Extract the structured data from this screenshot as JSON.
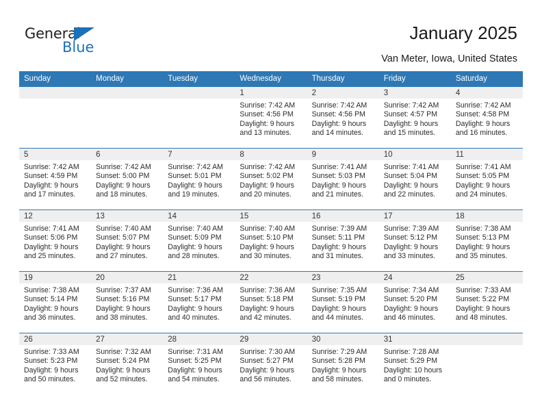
{
  "brand": {
    "name_top": "General",
    "name_bottom": "Blue",
    "accent_color": "#1c71b8"
  },
  "header": {
    "title": "January 2025",
    "subtitle": "Van Meter, Iowa, United States"
  },
  "calendar": {
    "header_background": "#2e78b5",
    "daynum_background": "#efefef",
    "weekday_headers": [
      "Sunday",
      "Monday",
      "Tuesday",
      "Wednesday",
      "Thursday",
      "Friday",
      "Saturday"
    ],
    "weeks": [
      [
        {
          "day": "",
          "lines": []
        },
        {
          "day": "",
          "lines": []
        },
        {
          "day": "",
          "lines": []
        },
        {
          "day": "1",
          "lines": [
            "Sunrise: 7:42 AM",
            "Sunset: 4:56 PM",
            "Daylight: 9 hours",
            "and 13 minutes."
          ]
        },
        {
          "day": "2",
          "lines": [
            "Sunrise: 7:42 AM",
            "Sunset: 4:56 PM",
            "Daylight: 9 hours",
            "and 14 minutes."
          ]
        },
        {
          "day": "3",
          "lines": [
            "Sunrise: 7:42 AM",
            "Sunset: 4:57 PM",
            "Daylight: 9 hours",
            "and 15 minutes."
          ]
        },
        {
          "day": "4",
          "lines": [
            "Sunrise: 7:42 AM",
            "Sunset: 4:58 PM",
            "Daylight: 9 hours",
            "and 16 minutes."
          ]
        }
      ],
      [
        {
          "day": "5",
          "lines": [
            "Sunrise: 7:42 AM",
            "Sunset: 4:59 PM",
            "Daylight: 9 hours",
            "and 17 minutes."
          ]
        },
        {
          "day": "6",
          "lines": [
            "Sunrise: 7:42 AM",
            "Sunset: 5:00 PM",
            "Daylight: 9 hours",
            "and 18 minutes."
          ]
        },
        {
          "day": "7",
          "lines": [
            "Sunrise: 7:42 AM",
            "Sunset: 5:01 PM",
            "Daylight: 9 hours",
            "and 19 minutes."
          ]
        },
        {
          "day": "8",
          "lines": [
            "Sunrise: 7:42 AM",
            "Sunset: 5:02 PM",
            "Daylight: 9 hours",
            "and 20 minutes."
          ]
        },
        {
          "day": "9",
          "lines": [
            "Sunrise: 7:41 AM",
            "Sunset: 5:03 PM",
            "Daylight: 9 hours",
            "and 21 minutes."
          ]
        },
        {
          "day": "10",
          "lines": [
            "Sunrise: 7:41 AM",
            "Sunset: 5:04 PM",
            "Daylight: 9 hours",
            "and 22 minutes."
          ]
        },
        {
          "day": "11",
          "lines": [
            "Sunrise: 7:41 AM",
            "Sunset: 5:05 PM",
            "Daylight: 9 hours",
            "and 24 minutes."
          ]
        }
      ],
      [
        {
          "day": "12",
          "lines": [
            "Sunrise: 7:41 AM",
            "Sunset: 5:06 PM",
            "Daylight: 9 hours",
            "and 25 minutes."
          ]
        },
        {
          "day": "13",
          "lines": [
            "Sunrise: 7:40 AM",
            "Sunset: 5:07 PM",
            "Daylight: 9 hours",
            "and 27 minutes."
          ]
        },
        {
          "day": "14",
          "lines": [
            "Sunrise: 7:40 AM",
            "Sunset: 5:09 PM",
            "Daylight: 9 hours",
            "and 28 minutes."
          ]
        },
        {
          "day": "15",
          "lines": [
            "Sunrise: 7:40 AM",
            "Sunset: 5:10 PM",
            "Daylight: 9 hours",
            "and 30 minutes."
          ]
        },
        {
          "day": "16",
          "lines": [
            "Sunrise: 7:39 AM",
            "Sunset: 5:11 PM",
            "Daylight: 9 hours",
            "and 31 minutes."
          ]
        },
        {
          "day": "17",
          "lines": [
            "Sunrise: 7:39 AM",
            "Sunset: 5:12 PM",
            "Daylight: 9 hours",
            "and 33 minutes."
          ]
        },
        {
          "day": "18",
          "lines": [
            "Sunrise: 7:38 AM",
            "Sunset: 5:13 PM",
            "Daylight: 9 hours",
            "and 35 minutes."
          ]
        }
      ],
      [
        {
          "day": "19",
          "lines": [
            "Sunrise: 7:38 AM",
            "Sunset: 5:14 PM",
            "Daylight: 9 hours",
            "and 36 minutes."
          ]
        },
        {
          "day": "20",
          "lines": [
            "Sunrise: 7:37 AM",
            "Sunset: 5:16 PM",
            "Daylight: 9 hours",
            "and 38 minutes."
          ]
        },
        {
          "day": "21",
          "lines": [
            "Sunrise: 7:36 AM",
            "Sunset: 5:17 PM",
            "Daylight: 9 hours",
            "and 40 minutes."
          ]
        },
        {
          "day": "22",
          "lines": [
            "Sunrise: 7:36 AM",
            "Sunset: 5:18 PM",
            "Daylight: 9 hours",
            "and 42 minutes."
          ]
        },
        {
          "day": "23",
          "lines": [
            "Sunrise: 7:35 AM",
            "Sunset: 5:19 PM",
            "Daylight: 9 hours",
            "and 44 minutes."
          ]
        },
        {
          "day": "24",
          "lines": [
            "Sunrise: 7:34 AM",
            "Sunset: 5:20 PM",
            "Daylight: 9 hours",
            "and 46 minutes."
          ]
        },
        {
          "day": "25",
          "lines": [
            "Sunrise: 7:33 AM",
            "Sunset: 5:22 PM",
            "Daylight: 9 hours",
            "and 48 minutes."
          ]
        }
      ],
      [
        {
          "day": "26",
          "lines": [
            "Sunrise: 7:33 AM",
            "Sunset: 5:23 PM",
            "Daylight: 9 hours",
            "and 50 minutes."
          ]
        },
        {
          "day": "27",
          "lines": [
            "Sunrise: 7:32 AM",
            "Sunset: 5:24 PM",
            "Daylight: 9 hours",
            "and 52 minutes."
          ]
        },
        {
          "day": "28",
          "lines": [
            "Sunrise: 7:31 AM",
            "Sunset: 5:25 PM",
            "Daylight: 9 hours",
            "and 54 minutes."
          ]
        },
        {
          "day": "29",
          "lines": [
            "Sunrise: 7:30 AM",
            "Sunset: 5:27 PM",
            "Daylight: 9 hours",
            "and 56 minutes."
          ]
        },
        {
          "day": "30",
          "lines": [
            "Sunrise: 7:29 AM",
            "Sunset: 5:28 PM",
            "Daylight: 9 hours",
            "and 58 minutes."
          ]
        },
        {
          "day": "31",
          "lines": [
            "Sunrise: 7:28 AM",
            "Sunset: 5:29 PM",
            "Daylight: 10 hours",
            "and 0 minutes."
          ]
        },
        {
          "day": "",
          "lines": []
        }
      ]
    ]
  }
}
